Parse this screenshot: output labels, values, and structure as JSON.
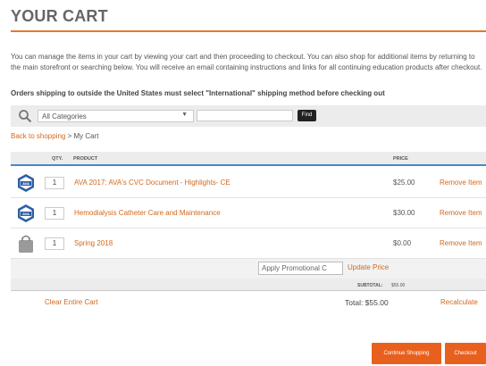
{
  "page": {
    "title": "YOUR CART",
    "intro": "You can manage the items in your cart by viewing your cart and then proceeding to checkout. You can also shop for additional items by returning to the main storefront or searching below. You will receive an email containing instructions and links for all continuing education products after checkout.",
    "notice": "Orders shipping to outside the United States must select \"International\" shipping method before checking out"
  },
  "search": {
    "category_value": "All Categories",
    "find_label": "Find",
    "icon": "search-icon"
  },
  "breadcrumb": {
    "link": "Back to shopping",
    "separator": ">",
    "current": "My Cart"
  },
  "table": {
    "headers": {
      "qty": "QTY.",
      "product": "PRODUCT",
      "price": "PRICE"
    },
    "rows": [
      {
        "qty": "1",
        "product": "AVA 2017: AVA's CVC Document - Highlights- CE",
        "price": "$25.00",
        "remove": "Remove Item",
        "thumb": "ava-logo-icon"
      },
      {
        "qty": "1",
        "product": "Hemodialysis Catheter Care and Maintenance",
        "price": "$30.00",
        "remove": "Remove Item",
        "thumb": "ava-logo-icon"
      },
      {
        "qty": "1",
        "product": "Spring 2018",
        "price": "$0.00",
        "remove": "Remove Item",
        "thumb": "shopping-bag-icon"
      }
    ]
  },
  "promo": {
    "placeholder": "Apply Promotional C",
    "button": "Update Price"
  },
  "subtotal": {
    "label": "SUBTOTAL:",
    "value": "$55.00"
  },
  "footer": {
    "clear_cart": "Clear Entire Cart",
    "total": "Total: $55.00",
    "recalculate": "Recalculate"
  },
  "actions": {
    "continue": "Continue Shopping",
    "checkout": "Checkout"
  },
  "colors": {
    "accent": "#e8601d",
    "link": "#d2691e",
    "header_rule": "#4a86c5"
  }
}
